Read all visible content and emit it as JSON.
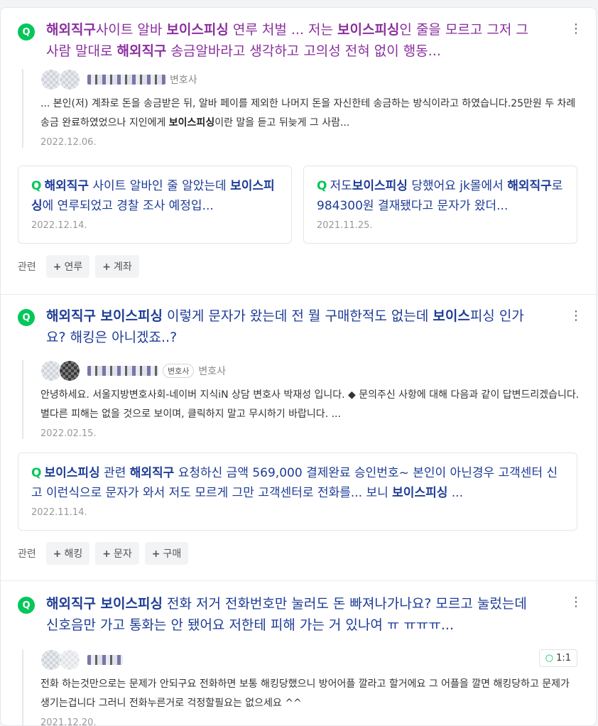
{
  "results": [
    {
      "title_html": "<b>해외직구</b>사이트 알바 <b>보이스피싱</b> 연루 처벌 ... 저는 <b>보이스피싱</b>인 줄을 모르고 그저 그 사람 말대로 <b>해외직구</b> 송금알바라고 생각하고 고의성 전혀 없이 행동...",
      "author_role": "변호사",
      "snippet_html": "... 본인(저) 계좌로 돈을 송금받은 뒤, 알바 페이를 제외한 나머지 돈을 자신한테 송금하는 방식이라고 하였습니다.25만원 두 차례 송금 완료하였었으나 지인에게 <b>보이스피싱</b>이란 말을 듣고 뒤늦게 그 사람...",
      "date": "2022.12.06.",
      "sub": [
        {
          "title_html": "<b>해외직구</b> 사이트 알바인 줄 알았는데 <b>보이스피싱</b>에 연루되었고 경찰 조사 예정입...",
          "date": "2022.12.14."
        },
        {
          "title_html": "저도<b>보이스피싱</b> 당했어요 jk몰에서 <b>해외직구</b>로 984300원 결재됐다고 문자가 왔더...",
          "date": "2021.11.25."
        }
      ],
      "related_label": "관련",
      "related": [
        "연루",
        "계좌"
      ]
    },
    {
      "title_html": "<b>해외직구 보이스피싱</b> 이렇게 문자가 왔는데 전 뭘 구매한적도 없는데 <b>보이스</b>피싱 인가요? 해킹은 아니겠죠..?",
      "author_badge": "변호사",
      "author_role": "변호사",
      "snippet": "안녕하세요. 서울지방변호사회-네이버 지식iN 상담 변호사 박재성 입니다. ◆ 문의주신 사항에 대해 다음과 같이 답변드리겠습니다. 별다른 피해는 없을 것으로 보이며, 클릭하지 말고 무시하기 바랍니다. ...",
      "date": "2022.02.15.",
      "sub": [
        {
          "title_html": "<b>보이스피싱</b> 관련 <b>해외직구</b> 요청하신 금액 569,000 결제완료 승인번호~ 본인이 아닌경우 고객센터 신고 이런식으로 문자가 와서 저도 모르게 그만 고객센터로 전화를... 보니 <b>보이스피싱</b> ...",
          "date": "2022.11.14."
        }
      ],
      "related_label": "관련",
      "related": [
        "해킹",
        "문자",
        "구매"
      ]
    },
    {
      "title_html": "<b>해외직구 보이스피싱</b> 전화 저거 전화번호만 눌러도 돈 빠져나가나요? 모르고 눌렀는데 신호음만 가고 통화는 안 됐어요 저한테 피해 가는 거 있나여 ㅠ ㅠㅠㅠ...",
      "reply_badge": "1:1",
      "snippet": "전화 하는것만으로는 문제가 안되구요 전화하면 보통 해킹당했으니 방어어플 깔라고 할거에요 그 어플을 깔면 해킹당하고 문제가 생기는겁니다 그러니 전화누른거로 걱정할필요는 없으세요 ^^",
      "date": "2021.12.20."
    }
  ],
  "icons": {
    "question": "Q",
    "more": "⋮",
    "plus": "+"
  },
  "colors": {
    "brand_green": "#03c75a",
    "link_blue": "#1d3c96",
    "visited_purple": "#8a2f9e"
  }
}
